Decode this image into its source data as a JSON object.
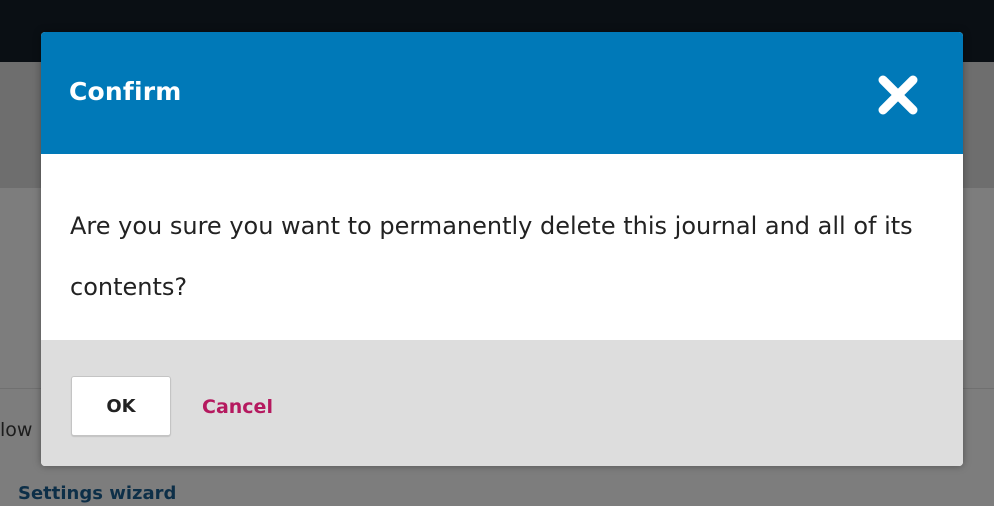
{
  "background": {
    "partial_text": "low",
    "link_text": "Settings wizard"
  },
  "dialog": {
    "title": "Confirm",
    "close_icon": "close-icon",
    "message": "Are you sure you want to permanently delete this journal and all of its contents?",
    "ok_label": "OK",
    "cancel_label": "Cancel"
  },
  "colors": {
    "header": "#0079b8",
    "footer": "#dddddd",
    "cancel": "#b5195f",
    "overlay": "#7f7f7f"
  }
}
